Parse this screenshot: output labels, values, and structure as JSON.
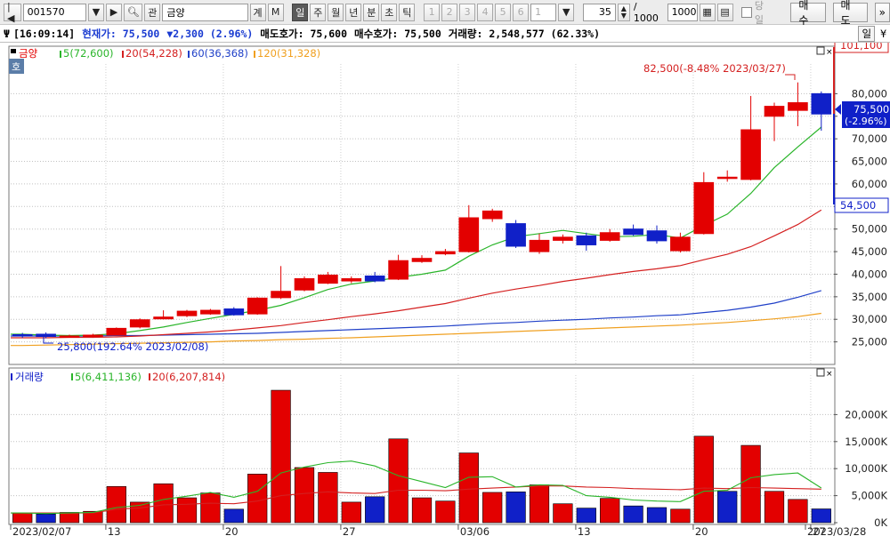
{
  "toolbar": {
    "code": "001570",
    "name": "금양",
    "buttons": [
      "계",
      "M"
    ],
    "periods": [
      "일",
      "주",
      "월",
      "년",
      "분",
      "초",
      "틱"
    ],
    "active_period": "일",
    "nums": [
      "1",
      "2",
      "3",
      "4",
      "5",
      "6"
    ],
    "num_select": "1",
    "count": "35",
    "slash": "/ 1000",
    "max": "1000",
    "today_label": "당일",
    "buy": "매수",
    "sell": "매도",
    "gwan": "관"
  },
  "status": {
    "time": "[16:09:14]",
    "cur_label": "현재가:",
    "cur_value": "75,500",
    "change": "▼2,300",
    "change_pct": "(2.96%)",
    "ask_label": "매도호가:",
    "ask_value": "75,600",
    "bid_label": "매수호가:",
    "bid_value": "75,500",
    "vol_label": "거래량:",
    "vol_value": "2,548,577",
    "vol_pct": "(62.33%)",
    "right_tab": "일"
  },
  "price_legend": {
    "name": "금양",
    "ma5": "5(72,600)",
    "ma20": "20(54,228)",
    "ma60": "60(36,368)",
    "ma120": "120(31,328)",
    "side_tag": "호"
  },
  "volume_legend": {
    "name": "거래량",
    "ma5": "5(6,411,136)",
    "ma20": "20(6,207,814)"
  },
  "annotations": {
    "high": "82,500(-8.48% 2023/03/27)",
    "low": "25,800(192.64% 2023/02/08)",
    "top_tag": "101,100",
    "cur_tag": "75,500",
    "cur_tag_pct": "(-2.96%)",
    "bottom_tag": "54,500"
  },
  "colors": {
    "up": "#e30000",
    "down": "#1020c8",
    "ma5": "#2ab52a",
    "ma20": "#d42020",
    "ma60": "#2040c8",
    "ma120": "#f0a020"
  },
  "chart_data": [
    {
      "type": "candlestick",
      "title": "금양",
      "ylim": [
        20000,
        85000
      ],
      "y_ticks": [
        25000,
        30000,
        35000,
        40000,
        45000,
        50000,
        55000,
        60000,
        65000,
        70000,
        75000,
        80000
      ],
      "y_tick_labels": [
        "25,000",
        "30,000",
        "35,000",
        "40,000",
        "45,000",
        "50,000",
        "55,000",
        "60,000",
        "65,000",
        "70,000",
        "75,000",
        "80,000"
      ],
      "x_labels": [
        "2023/02/07",
        "13",
        "20",
        "27",
        "03/06",
        "13",
        "20",
        "27",
        "2023/03/28"
      ],
      "x_label_index": [
        0,
        4,
        9,
        14,
        19,
        24,
        29,
        34,
        35
      ],
      "ohlc": [
        [
          26600,
          27000,
          25900,
          26500
        ],
        [
          26700,
          27100,
          25800,
          26200
        ],
        [
          26000,
          26600,
          25900,
          26300
        ],
        [
          26300,
          26800,
          26000,
          26500
        ],
        [
          26500,
          28200,
          26400,
          28000
        ],
        [
          28300,
          30200,
          28000,
          29900
        ],
        [
          30100,
          32000,
          30000,
          30500
        ],
        [
          30800,
          32100,
          30500,
          31800
        ],
        [
          31200,
          32300,
          31000,
          32000
        ],
        [
          32300,
          32700,
          30800,
          31000
        ],
        [
          31200,
          34900,
          31000,
          34700
        ],
        [
          34800,
          41800,
          34500,
          36200
        ],
        [
          36500,
          39500,
          36200,
          39000
        ],
        [
          38000,
          40500,
          37800,
          39800
        ],
        [
          38500,
          39500,
          38000,
          39000
        ],
        [
          39600,
          40500,
          38200,
          38500
        ],
        [
          38900,
          44300,
          38700,
          43000
        ],
        [
          42800,
          44200,
          42500,
          43500
        ],
        [
          44500,
          45600,
          44200,
          45000
        ],
        [
          45000,
          55300,
          44800,
          52500
        ],
        [
          52300,
          54500,
          51600,
          54000
        ],
        [
          51200,
          52000,
          45800,
          46200
        ],
        [
          45000,
          49000,
          44500,
          47500
        ],
        [
          47500,
          48800,
          46800,
          48200
        ],
        [
          48500,
          49200,
          45200,
          46500
        ],
        [
          47500,
          50000,
          47200,
          49200
        ],
        [
          50000,
          51000,
          48500,
          48800
        ],
        [
          49600,
          50800,
          46800,
          47400
        ],
        [
          45200,
          49200,
          44800,
          48200
        ],
        [
          49000,
          62600,
          48800,
          60300
        ],
        [
          61500,
          63000,
          60500,
          61500
        ],
        [
          61000,
          79500,
          60800,
          72000
        ],
        [
          75000,
          78000,
          69500,
          77200
        ],
        [
          76300,
          82500,
          72800,
          78000
        ],
        [
          80000,
          80500,
          71800,
          75500
        ]
      ],
      "ma5": [
        26700,
        26500,
        26400,
        26500,
        26800,
        27500,
        28300,
        29300,
        30200,
        31100,
        32000,
        33100,
        34800,
        36600,
        37800,
        38500,
        39300,
        40000,
        40900,
        44000,
        46500,
        48300,
        49000,
        49700,
        49000,
        48300,
        48400,
        48800,
        48000,
        50800,
        53300,
        57900,
        63600,
        68200,
        72600
      ],
      "ma20": [
        25900,
        25900,
        26000,
        26000,
        26100,
        26300,
        26600,
        26900,
        27200,
        27600,
        28100,
        28600,
        29300,
        29900,
        30600,
        31200,
        31900,
        32700,
        33500,
        34700,
        35800,
        36700,
        37500,
        38400,
        39100,
        39900,
        40600,
        41200,
        41900,
        43200,
        44400,
        46100,
        48500,
        51000,
        54228
      ],
      "ma60": [
        26300,
        26300,
        26300,
        26300,
        26400,
        26400,
        26500,
        26600,
        26700,
        26800,
        26900,
        27100,
        27300,
        27500,
        27700,
        27900,
        28100,
        28300,
        28500,
        28800,
        29100,
        29300,
        29600,
        29800,
        30000,
        30300,
        30500,
        30800,
        31000,
        31500,
        32000,
        32700,
        33600,
        34900,
        36368
      ],
      "ma120": [
        24200,
        24300,
        24400,
        24500,
        24600,
        24700,
        24800,
        24900,
        25000,
        25200,
        25300,
        25500,
        25600,
        25800,
        25900,
        26100,
        26300,
        26500,
        26700,
        26900,
        27100,
        27300,
        27500,
        27700,
        27900,
        28100,
        28300,
        28500,
        28700,
        29000,
        29300,
        29700,
        30100,
        30600,
        31328
      ]
    },
    {
      "type": "bar",
      "title": "거래량",
      "ylim": [
        0,
        25000
      ],
      "y_ticks": [
        0,
        5000,
        10000,
        15000,
        20000
      ],
      "y_tick_labels": [
        "0K",
        "5,000K",
        "10,000K",
        "15,000K",
        "20,000K"
      ],
      "values": [
        1800,
        1600,
        1900,
        2100,
        6700,
        3800,
        7200,
        4600,
        5500,
        2500,
        9000,
        24500,
        10200,
        9300,
        3800,
        4800,
        15500,
        4600,
        4000,
        12900,
        5600,
        5700,
        7000,
        3500,
        2700,
        4500,
        3100,
        2800,
        2500,
        16000,
        5800,
        14300,
        5800,
        4300,
        2548
      ],
      "up": [
        true,
        false,
        true,
        true,
        true,
        true,
        true,
        true,
        true,
        false,
        true,
        true,
        true,
        true,
        true,
        false,
        true,
        true,
        true,
        true,
        true,
        false,
        true,
        true,
        false,
        true,
        false,
        false,
        true,
        true,
        false,
        true,
        true,
        true,
        false
      ],
      "ma5": [
        1800,
        1700,
        1800,
        1900,
        2800,
        3200,
        4300,
        4900,
        5600,
        4700,
        5800,
        9200,
        10300,
        11100,
        11400,
        10500,
        8700,
        7600,
        6500,
        8400,
        8500,
        6600,
        7000,
        6900,
        5000,
        4700,
        4200,
        4000,
        3900,
        5800,
        6000,
        8300,
        8900,
        9200,
        6411
      ],
      "ma20": [
        1800,
        1800,
        1800,
        1800,
        2500,
        2700,
        3300,
        3400,
        3600,
        3500,
        4000,
        5000,
        5400,
        5700,
        5500,
        5400,
        6000,
        6000,
        5900,
        6200,
        6400,
        6600,
        6800,
        6800,
        6600,
        6500,
        6300,
        6200,
        6100,
        6400,
        6300,
        6500,
        6400,
        6300,
        6208
      ]
    }
  ]
}
